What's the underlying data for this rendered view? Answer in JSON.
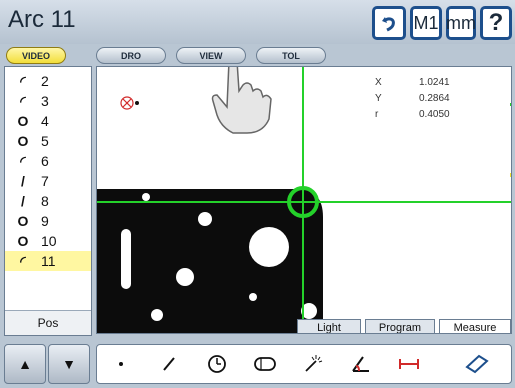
{
  "header": {
    "title": "Arc 11",
    "measure_mode": "M1",
    "units": "mm",
    "help": "?"
  },
  "tabs": [
    {
      "label": "VIDEO",
      "active": true
    },
    {
      "label": "DRO",
      "active": false
    },
    {
      "label": "VIEW",
      "active": false
    },
    {
      "label": "TOL",
      "active": false
    }
  ],
  "feature_list": [
    {
      "icon": "arc",
      "glyph": "◜",
      "num": "2"
    },
    {
      "icon": "arc",
      "glyph": "◜",
      "num": "3"
    },
    {
      "icon": "circle",
      "glyph": "O",
      "num": "4"
    },
    {
      "icon": "circle",
      "glyph": "O",
      "num": "5"
    },
    {
      "icon": "arc",
      "glyph": "◜",
      "num": "6"
    },
    {
      "icon": "line",
      "glyph": "/",
      "num": "7"
    },
    {
      "icon": "line",
      "glyph": "/",
      "num": "8"
    },
    {
      "icon": "circle",
      "glyph": "O",
      "num": "9"
    },
    {
      "icon": "circle",
      "glyph": "O",
      "num": "10"
    },
    {
      "icon": "arc",
      "glyph": "◜",
      "num": "11",
      "selected": true
    }
  ],
  "pos_label": "Pos",
  "readout": {
    "x_label": "X",
    "x_value": "1.0241",
    "y_label": "Y",
    "y_value": "0.2864",
    "r_label": "r",
    "r_value": "0.4050"
  },
  "view_tabs": [
    {
      "label": "Light",
      "active": false
    },
    {
      "label": "Program",
      "active": false
    },
    {
      "label": "Measure",
      "active": true
    }
  ],
  "colors": {
    "crosshair": "#24d12a",
    "highlight": "#f4e42c",
    "accent": "#1d4f8c"
  }
}
